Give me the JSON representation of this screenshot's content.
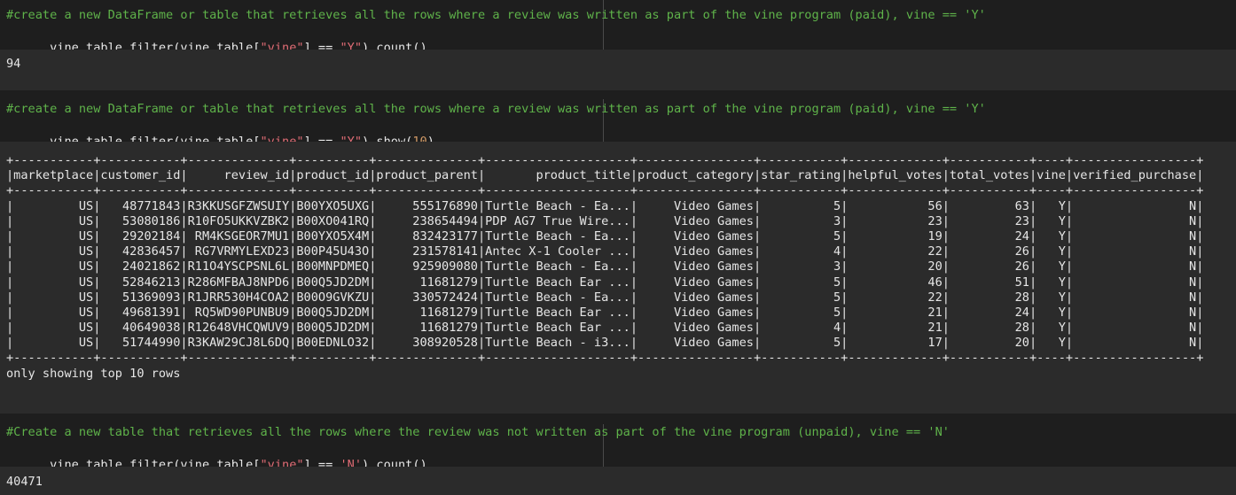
{
  "cells": [
    {
      "comment": "#create a new DataFrame or table that retrieves all the rows where a review was written as part of the vine program (paid), vine == 'Y'",
      "code_prefix": "vine_table.filter(vine_table[",
      "code_str1": "\"vine\"",
      "code_mid": "] == ",
      "code_str2": "\"Y\"",
      "code_suffix": ").count()",
      "output": "94"
    },
    {
      "comment": "#create a new DataFrame or table that retrieves all the rows where a review was written as part of the vine program (paid), vine == 'Y'",
      "code_prefix": "vine_table.filter(vine_table[",
      "code_str1": "\"vine\"",
      "code_mid": "] == ",
      "code_str2": "\"Y\"",
      "code_suffix": ").show(",
      "code_num": "10",
      "code_end": ")",
      "output_footer": "only showing top 10 rows"
    },
    {
      "comment": "#Create a new table that retrieves all the rows where the review was not written as part of the vine program (unpaid), vine == 'N'",
      "code_prefix": "vine_table.filter(vine_table[",
      "code_str1": "\"vine\"",
      "code_mid": "] == ",
      "code_str2": "'N'",
      "code_suffix": ").count()",
      "output": "40471"
    }
  ],
  "table": {
    "border": "+-----------+-----------+--------------+----------+--------------+--------------------+----------------+-----------+-------------+-----------+----+-----------------+",
    "header": "|marketplace|customer_id|     review_id|product_id|product_parent|       product_title|product_category|star_rating|helpful_votes|total_votes|vine|verified_purchase|",
    "rows": [
      "|         US|   48771843|R3KKUSGFZWSUIY|B00YXO5UXG|     555176890|Turtle Beach - Ea...|     Video Games|          5|           56|         63|   Y|                N|",
      "|         US|   53080186|R10FO5UKKVZBK2|B00XO041RQ|     238654494|PDP AG7 True Wire...|     Video Games|          3|           23|         23|   Y|                N|",
      "|         US|   29202184| RM4KSGEOR7MU1|B00YXO5X4M|     832423177|Turtle Beach - Ea...|     Video Games|          5|           19|         24|   Y|                N|",
      "|         US|   42836457| RG7VRMYLEXD23|B00P45U43O|     231578141|Antec X-1 Cooler ...|     Video Games|          4|           22|         26|   Y|                N|",
      "|         US|   24021862|R11O4YSCPSNL6L|B00MNPDMEQ|     925909080|Turtle Beach - Ea...|     Video Games|          3|           20|         26|   Y|                N|",
      "|         US|   52846213|R286MFBAJ8NPD6|B00Q5JD2DM|      11681279|Turtle Beach Ear ...|     Video Games|          5|           46|         51|   Y|                N|",
      "|         US|   51369093|R1JRR530H4COA2|B00O9GVKZU|     330572424|Turtle Beach - Ea...|     Video Games|          5|           22|         28|   Y|                N|",
      "|         US|   49681391| RQ5WD90PUNBU9|B00Q5JD2DM|      11681279|Turtle Beach Ear ...|     Video Games|          5|           21|         24|   Y|                N|",
      "|         US|   40649038|R12648VHCQWUV9|B00Q5JD2DM|      11681279|Turtle Beach Ear ...|     Video Games|          4|           21|         28|   Y|                N|",
      "|         US|   51744990|R3KAW29CJ8L6DQ|B00EDNLO32|     308920528|Turtle Beach - i3...|     Video Games|          5|           17|         20|   Y|                N|"
    ]
  }
}
